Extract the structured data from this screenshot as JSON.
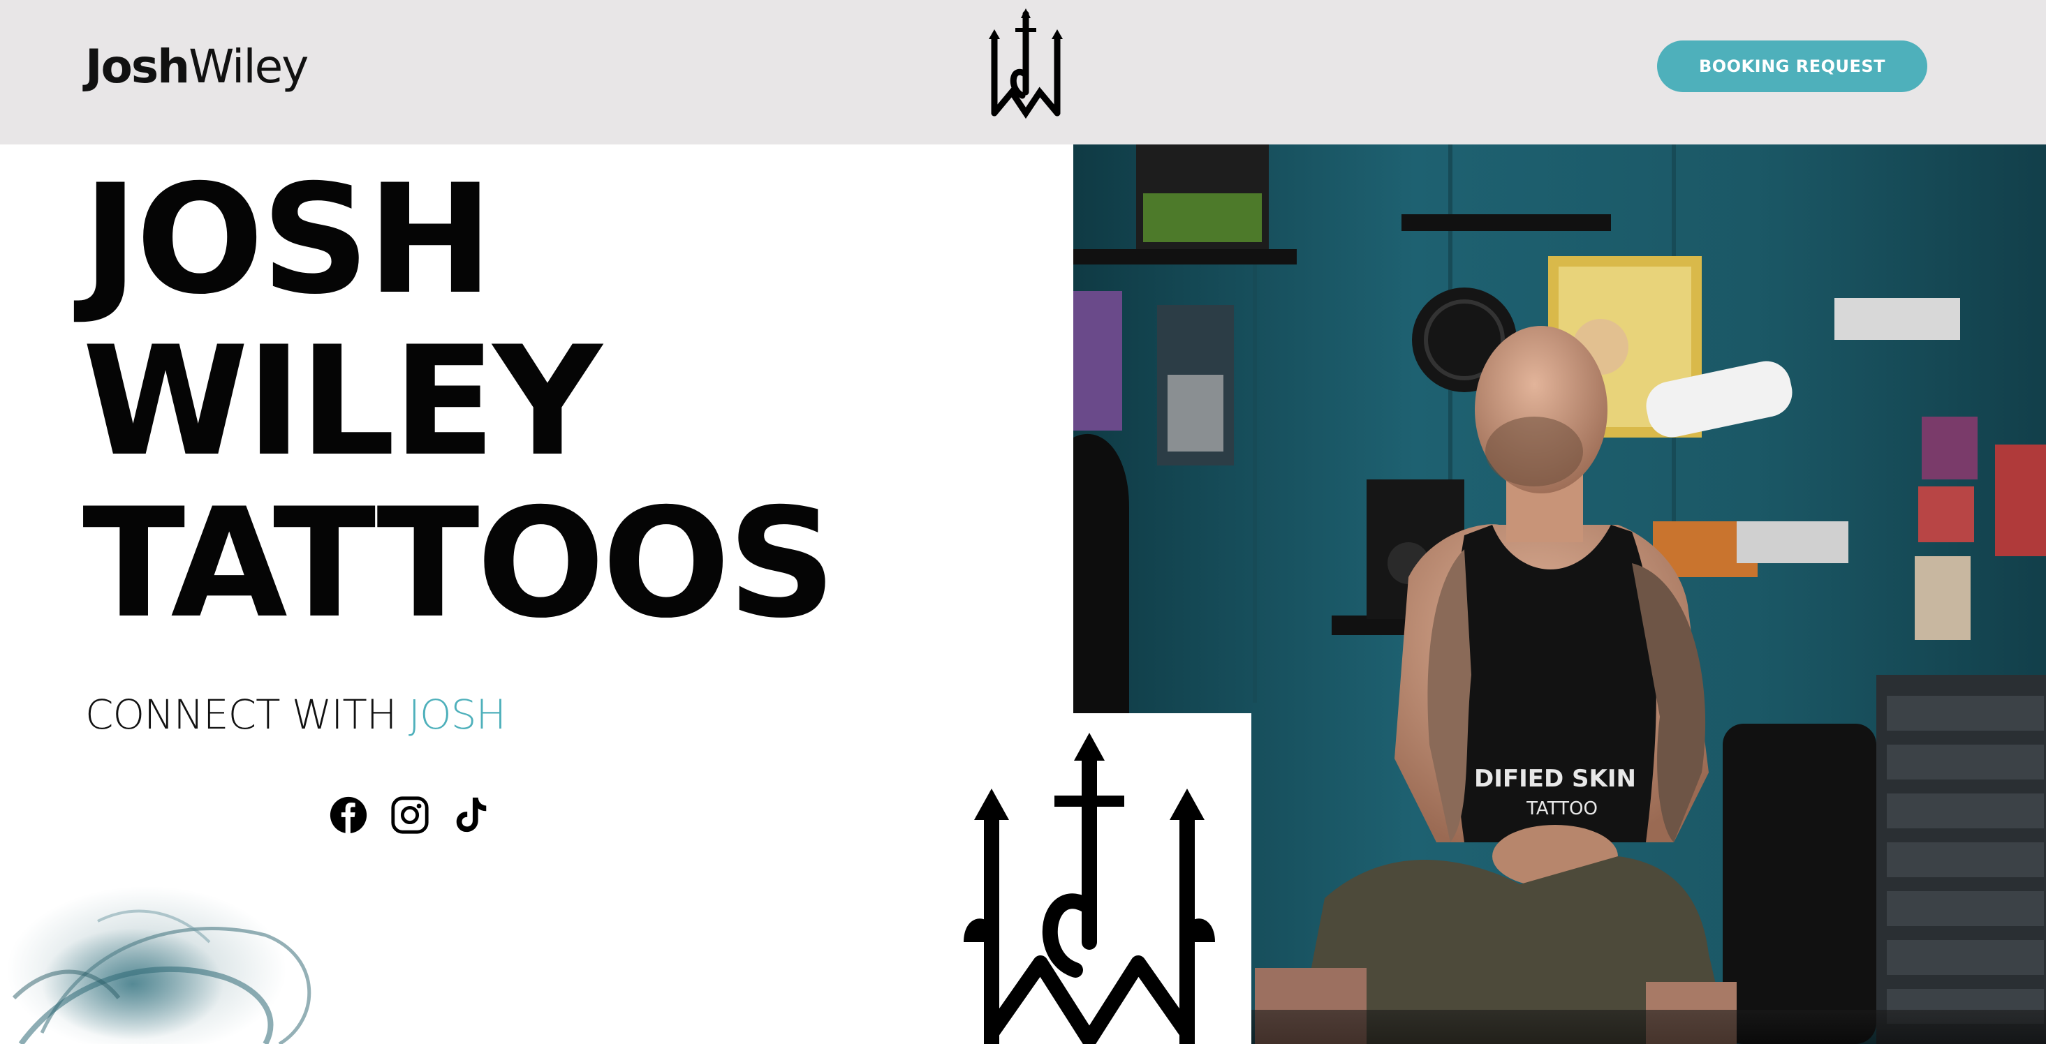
{
  "header": {
    "brand_bold": "Josh",
    "brand_light": "Wiley",
    "booking_label": "BOOKING REQUEST"
  },
  "hero": {
    "title_lines": [
      "JOSH",
      "WILEY",
      "TATTOOS"
    ],
    "connect_prefix": "CONNECT WITH ",
    "connect_accent": "JOSH"
  },
  "socials": [
    {
      "name": "facebook-icon"
    },
    {
      "name": "instagram-icon"
    },
    {
      "name": "tiktok-icon"
    }
  ],
  "colors": {
    "accent": "#4eb0bb",
    "header_bg": "#e8e6e7",
    "wall_teal": "#1f5f6e"
  }
}
